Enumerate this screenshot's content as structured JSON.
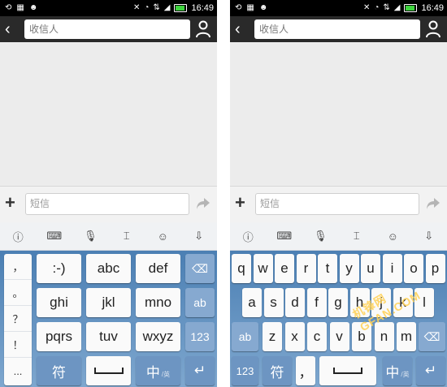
{
  "status_bar": {
    "time": "16:49"
  },
  "header": {
    "recipient_placeholder": "收信人"
  },
  "composer": {
    "placeholder": "短信"
  },
  "toolbar": {
    "items": [
      "logo-icon",
      "keyboard-icon",
      "microphone-icon",
      "text-cursor-icon",
      "emoji-icon",
      "collapse-keyboard-icon"
    ]
  },
  "left_keyboard": {
    "side_column": [
      "，",
      "。",
      "？",
      "！",
      "..."
    ],
    "row1": [
      ":-)",
      "abc",
      "def"
    ],
    "row2": [
      "ghi",
      "jkl",
      "mno"
    ],
    "row3": [
      "pqrs",
      "tuv",
      "wxyz"
    ],
    "right_column": [
      "ab",
      "123"
    ],
    "bottom": {
      "symbol": "符",
      "lang_main": "中",
      "lang_sub": "/英"
    }
  },
  "right_keyboard": {
    "row1": [
      "q",
      "w",
      "e",
      "r",
      "t",
      "y",
      "u",
      "i",
      "o",
      "p"
    ],
    "row2": [
      "a",
      "s",
      "d",
      "f",
      "g",
      "h",
      "j",
      "k",
      "l"
    ],
    "row3": [
      "z",
      "x",
      "c",
      "v",
      "b",
      "n",
      "m"
    ],
    "row3_left": "ab",
    "bottom": {
      "num": "123",
      "symbol": "符",
      "comma": "，",
      "lang_main": "中",
      "lang_sub": "/英"
    }
  },
  "watermark": {
    "text": "机锋网 GFAN.COM"
  },
  "colors": {
    "keyboard_top": "#4b7fb3",
    "keyboard_bottom": "#7ea7cf",
    "battery": "#3fd43f"
  }
}
